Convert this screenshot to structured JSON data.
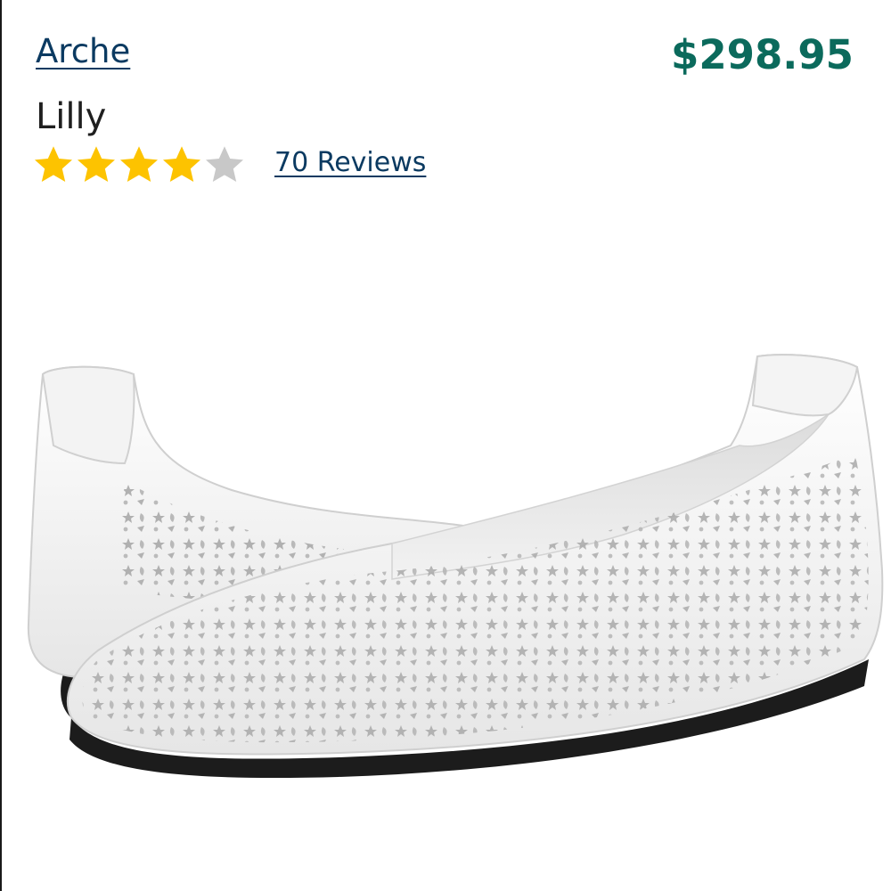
{
  "product": {
    "brand": "Arche",
    "name": "Lilly",
    "price": "$298.95",
    "rating": {
      "value": 4,
      "max": 5
    },
    "reviews_label": "70 Reviews",
    "image_icon": "product-photo-shoes"
  },
  "colors": {
    "link": "#0b3a61",
    "price": "#0b6a5c",
    "star_filled": "#fdc300",
    "star_empty": "#c8c8c8"
  }
}
